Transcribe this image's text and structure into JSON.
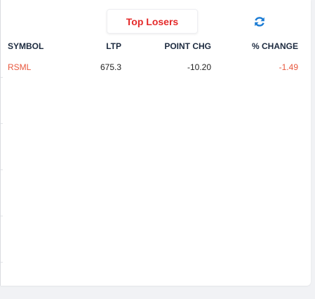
{
  "widget": {
    "active_tab": "Top Losers",
    "refresh_icon": "refresh-icon",
    "accent_color": "#e42a2a",
    "loss_color": "#e8573d",
    "refresh_color": "#1a7bd4"
  },
  "table": {
    "headers": {
      "symbol": "SYMBOL",
      "ltp": "LTP",
      "point_chg": "POINT CHG",
      "pct_change": "% CHANGE"
    },
    "rows": [
      {
        "symbol": "RSML",
        "ltp": "675.3",
        "point_chg": "-10.20",
        "pct_change": "-1.49"
      }
    ]
  }
}
